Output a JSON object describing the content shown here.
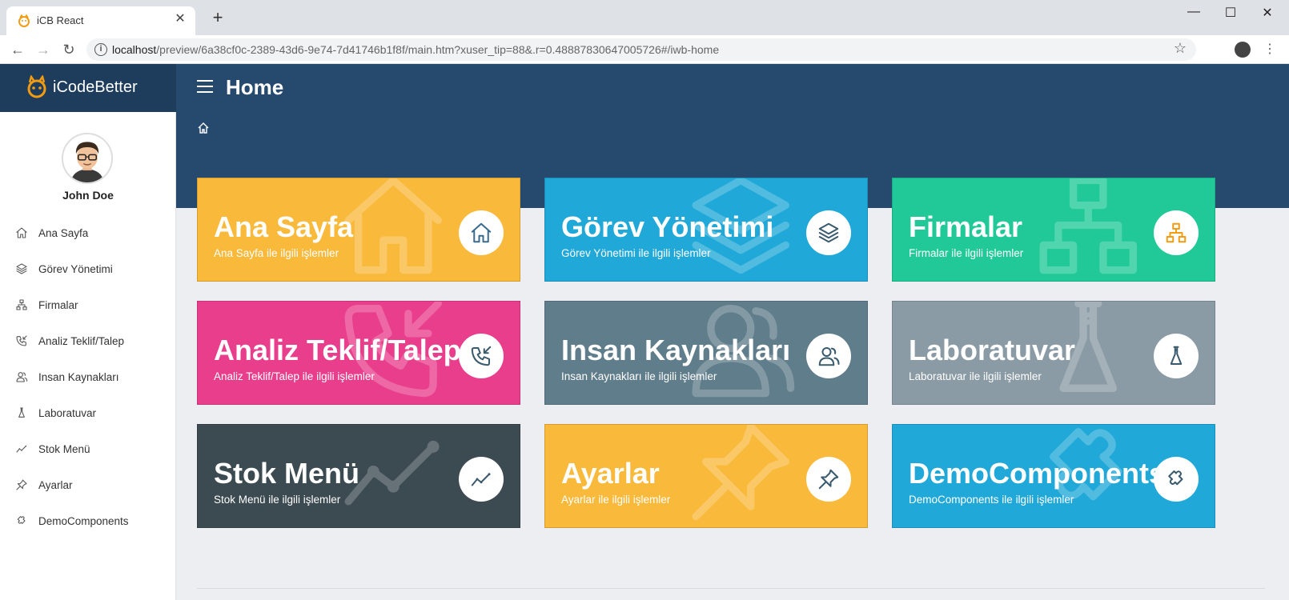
{
  "browser": {
    "tab_title": "iCB React",
    "url_host": "localhost",
    "url_path": "/preview/6a38cf0c-2389-43d6-9e74-7d41746b1f8f/main.htm?xuser_tip=88&.r=0.48887830647005726#/iwb-home"
  },
  "app": {
    "brand_name": "iCodeBetter",
    "page_title": "Home",
    "user_name": "John Doe"
  },
  "sidebar": {
    "items": [
      {
        "label": "Ana Sayfa",
        "icon": "home-icon"
      },
      {
        "label": "Görev Yönetimi",
        "icon": "layers-icon"
      },
      {
        "label": "Firmalar",
        "icon": "sitemap-icon"
      },
      {
        "label": "Analiz Teklif/Talep",
        "icon": "phone-incoming-icon"
      },
      {
        "label": "Insan Kaynakları",
        "icon": "users-icon"
      },
      {
        "label": "Laboratuvar",
        "icon": "chemistry-icon"
      },
      {
        "label": "Stok Menü",
        "icon": "chart-line-icon"
      },
      {
        "label": "Ayarlar",
        "icon": "pin-icon"
      },
      {
        "label": "DemoComponents",
        "icon": "puzzle-icon"
      }
    ]
  },
  "tiles": [
    {
      "title": "Ana Sayfa",
      "subtitle": "Ana Sayfa ile ilgili işlemler",
      "color": "#f9b93b",
      "icon": "home-icon"
    },
    {
      "title": "Görev Yönetimi",
      "subtitle": "Görev Yönetimi ile ilgili işlemler",
      "color": "#20a8d8",
      "icon": "layers-icon"
    },
    {
      "title": "Firmalar",
      "subtitle": "Firmalar ile ilgili işlemler",
      "color": "#20c997",
      "icon": "sitemap-icon"
    },
    {
      "title": "Analiz Teklif/Talep",
      "subtitle": "Analiz Teklif/Talep ile ilgili işlemler",
      "color": "#e83e8c",
      "icon": "phone-incoming-icon"
    },
    {
      "title": "Insan Kaynakları",
      "subtitle": "Insan Kaynakları ile ilgili işlemler",
      "color": "#607d8b",
      "icon": "users-icon"
    },
    {
      "title": "Laboratuvar",
      "subtitle": "Laboratuvar ile ilgili işlemler",
      "color": "#8a9ba5",
      "icon": "chemistry-icon"
    },
    {
      "title": "Stok Menü",
      "subtitle": "Stok Menü ile ilgili işlemler",
      "color": "#3c4a52",
      "icon": "chart-line-icon"
    },
    {
      "title": "Ayarlar",
      "subtitle": "Ayarlar ile ilgili işlemler",
      "color": "#f9b93b",
      "icon": "pin-icon"
    },
    {
      "title": "DemoComponents",
      "subtitle": "DemoComponents ile ilgili işlemler",
      "color": "#20a8d8",
      "icon": "puzzle-icon"
    }
  ]
}
